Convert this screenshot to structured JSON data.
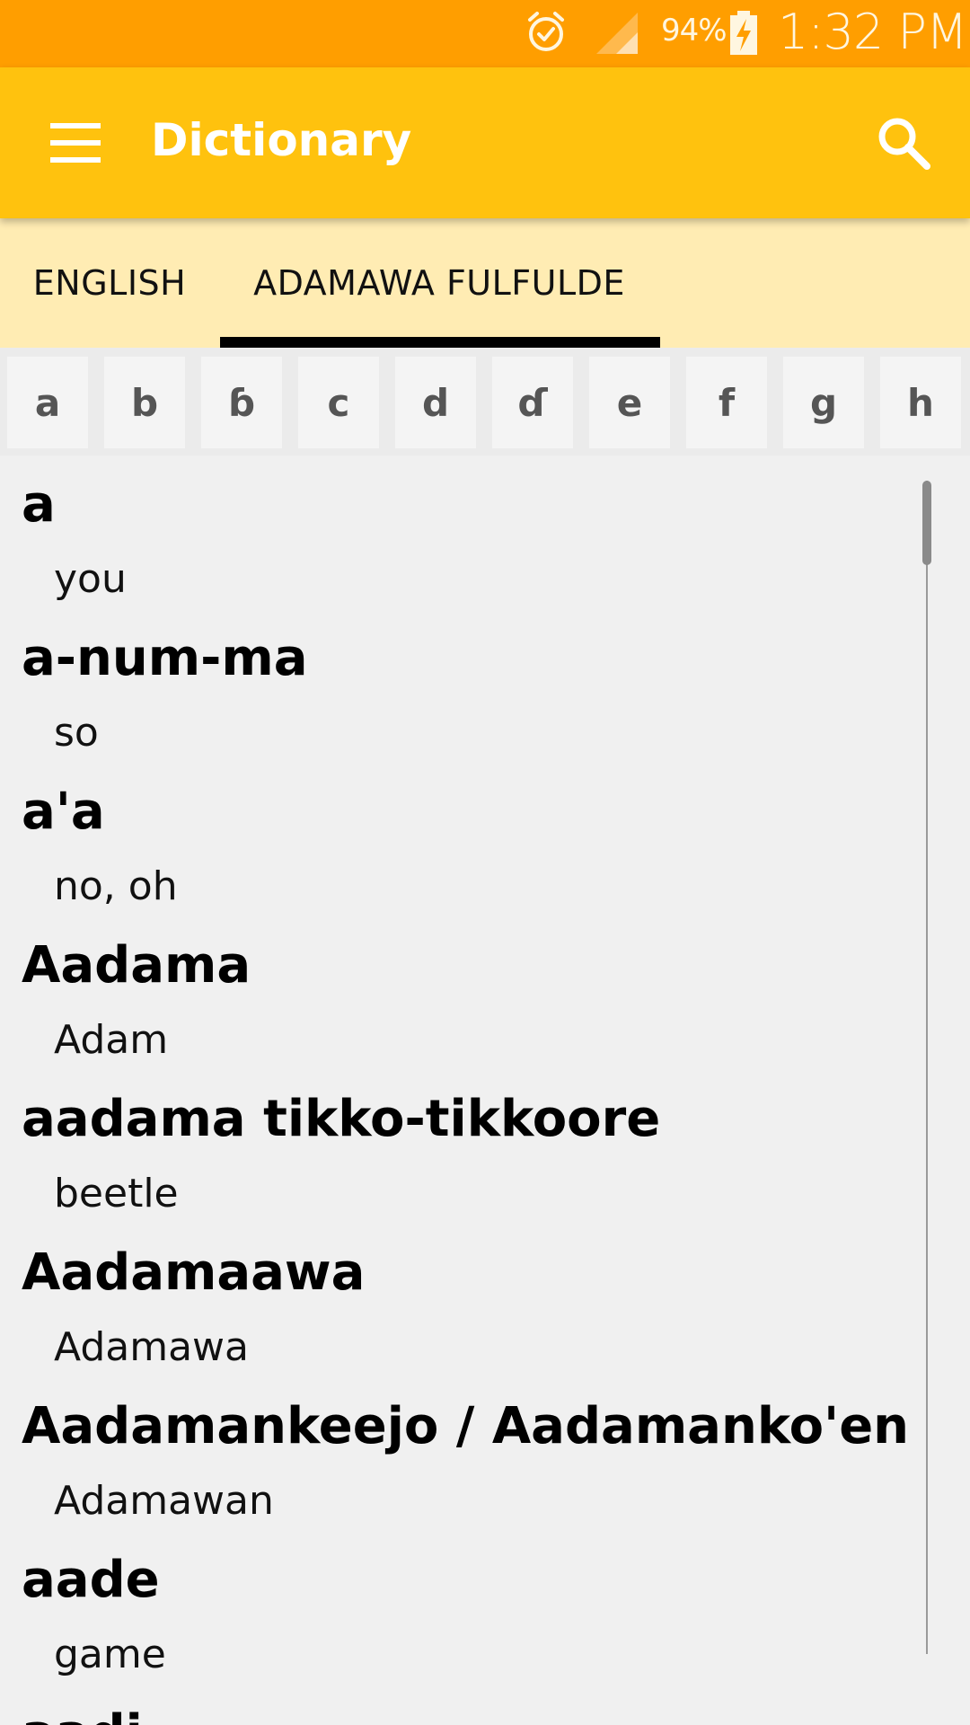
{
  "status_bar": {
    "battery_percent": "94%",
    "time": "1:32 PM",
    "icons": [
      "alarm-icon",
      "signal-icon",
      "battery-charging-icon"
    ]
  },
  "app_bar": {
    "title": "Dictionary",
    "menu_icon": "menu-icon",
    "search_icon": "search-icon",
    "color": "#ffc20e"
  },
  "tabs": [
    {
      "label": "ENGLISH",
      "selected": false
    },
    {
      "label": "ADAMAWA FULFULDE",
      "selected": true
    }
  ],
  "letters": [
    "a",
    "b",
    "ɓ",
    "c",
    "d",
    "ɗ",
    "e",
    "f",
    "g",
    "h"
  ],
  "entries": [
    {
      "word": "a",
      "definition": "you"
    },
    {
      "word": "a-num-ma",
      "definition": "so"
    },
    {
      "word": "a'a",
      "definition": "no, oh"
    },
    {
      "word": "Aadama",
      "definition": "Adam"
    },
    {
      "word": "aadama tikko-tikkoore",
      "definition": "beetle"
    },
    {
      "word": "Aadamaawa",
      "definition": "Adamawa"
    },
    {
      "word": "Aadamankeejo / Aadamanko'en",
      "definition": "Adamawan"
    },
    {
      "word": "aade",
      "definition": "game"
    },
    {
      "word": "aadi",
      "definition": ""
    }
  ],
  "colors": {
    "status_bar": "#ff9e00",
    "tab_bar": "#ffecb3",
    "background": "#f0f0f0"
  }
}
